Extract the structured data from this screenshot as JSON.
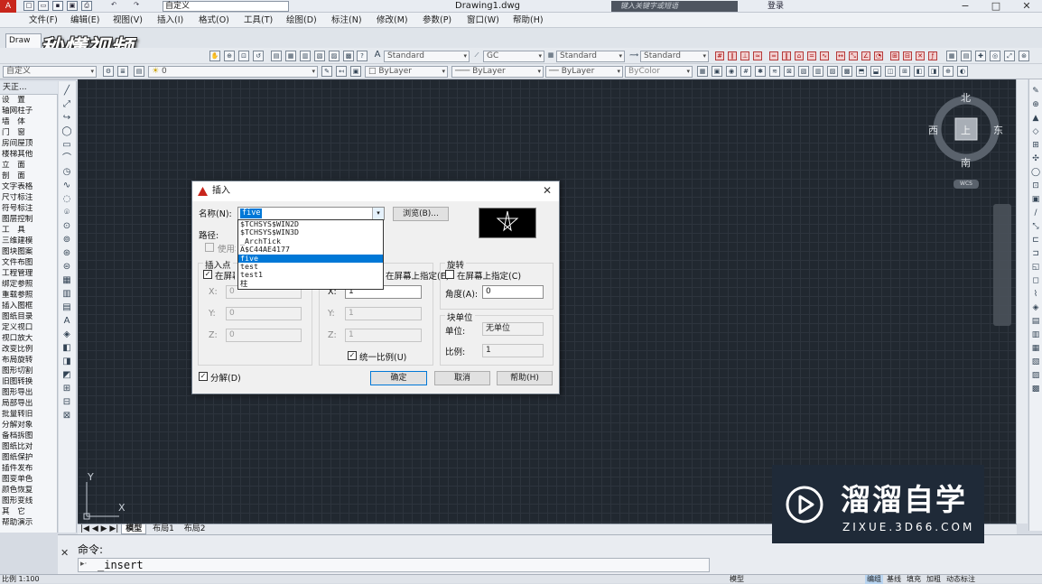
{
  "title_bar": {
    "workspace": "自定义",
    "document_title": "Drawing1.dwg",
    "search_placeholder": "键入关键字或短语",
    "login": "登录",
    "controls": [
      "−",
      "□",
      "✕"
    ]
  },
  "menu": [
    "文件(F)",
    "编辑(E)",
    "视图(V)",
    "插入(I)",
    "格式(O)",
    "工具(T)",
    "绘图(D)",
    "标注(N)",
    "修改(M)",
    "参数(P)",
    "窗口(W)",
    "帮助(H)"
  ],
  "doc_tab": "Draw",
  "watermark": "秒懂视频",
  "toolbar": {
    "text_style": "Standard",
    "dim_style": "GC",
    "table_style": "Standard",
    "ml_style": "Standard",
    "workspace_combo": "自定义",
    "layer": "0",
    "color": "ByLayer",
    "linetype": "ByLayer",
    "lineweight": "ByLayer",
    "plotstyle": "ByColor"
  },
  "left_panel": {
    "title": "天正...",
    "items": [
      "设　置",
      "轴网柱子",
      "墙　体",
      "门　窗",
      "房间屋顶",
      "楼梯其他",
      "立　面",
      "剖　面",
      "文字表格",
      "尺寸标注",
      "符号标注",
      "图层控制",
      "工　具",
      "三维建模",
      "图块图案",
      "文件布图",
      "工程管理",
      "绑定参照",
      "重载参照",
      "插入图框",
      "图纸目录",
      "定义视口",
      "视口放大",
      "改变比例",
      "布局旋转",
      "图形切割",
      "旧图转换",
      "图形导出",
      "局部导出",
      "批量转旧",
      "分解对象",
      "备档拆图",
      "图纸比对",
      "图纸保护",
      "插件发布",
      "图变单色",
      "颜色恢复",
      "图形变线",
      "其　它",
      "帮助演示"
    ]
  },
  "compass": {
    "north": "北",
    "south": "南",
    "east": "东",
    "west": "西",
    "top": "上",
    "wcs": "WCS"
  },
  "ucs": {
    "x": "X",
    "y": "Y"
  },
  "layout_tabs": [
    "模型",
    "布局1",
    "布局2"
  ],
  "command": {
    "label": "命令:",
    "current": "_insert"
  },
  "statusbar": {
    "scale": "比例 1:100",
    "right": "模型",
    "buttons": [
      "编组",
      "基线",
      "填充",
      "加粗",
      "动态标注"
    ]
  },
  "dialog": {
    "title": "插入",
    "name_label": "名称(N):",
    "name_value": "five",
    "browse_button": "浏览(B)...",
    "path_label": "路径:",
    "use_geo_label": "使用地理数据进行定位(G)",
    "dropdown_options": [
      "$TCHSYS$WIN2D",
      "$TCHSYS$WIN3D",
      "_ArchTick",
      "A$C44AE4177",
      "five",
      "test",
      "test1",
      "柱"
    ],
    "dropdown_selected": "five",
    "insertion": {
      "legend": "插入点",
      "on_screen": "在屏幕上指定(S)",
      "x_label": "X:",
      "x": "0",
      "y_label": "Y:",
      "y": "0",
      "z_label": "Z:",
      "z": "0"
    },
    "scale": {
      "legend": "比例",
      "on_screen": "在屏幕上指定(E)",
      "x_label": "X:",
      "x": "1",
      "y_label": "Y:",
      "y": "1",
      "z_label": "Z:",
      "z": "1",
      "uniform": "统一比例(U)"
    },
    "rotation": {
      "legend": "旋转",
      "on_screen": "在屏幕上指定(C)",
      "angle_label": "角度(A):",
      "angle": "0"
    },
    "block_unit": {
      "legend": "块单位",
      "unit_label": "单位:",
      "unit": "无单位",
      "factor_label": "比例:",
      "factor": "1"
    },
    "explode": "分解(D)",
    "ok": "确定",
    "cancel": "取消",
    "help": "帮助(H)"
  },
  "brand": {
    "name": "溜溜自学",
    "url": "ZIXUE.3D66.COM"
  },
  "colors": {
    "canvas": "#212830",
    "accent": "#0078d7",
    "app_red": "#c8261c"
  }
}
